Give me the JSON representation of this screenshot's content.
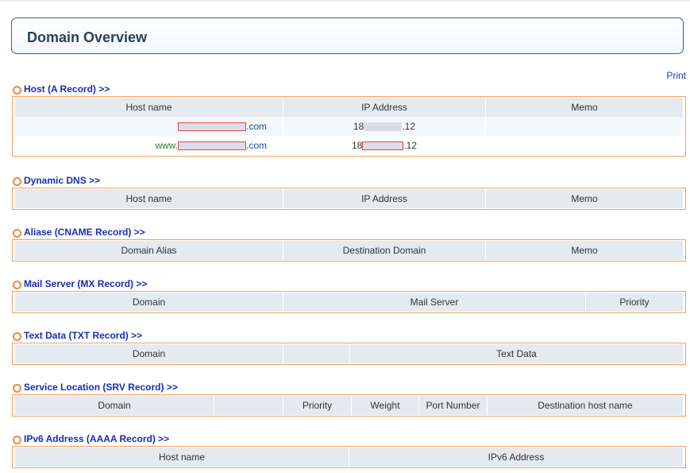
{
  "title": "Domain Overview",
  "print_label": "Print",
  "sections": {
    "a_record": {
      "title": "Host (A Record) >>",
      "headers": [
        "Host name",
        "IP Address",
        "Memo"
      ],
      "rows": [
        {
          "host_prefix": "",
          "host_suffix": ".com",
          "ip_prefix": "18",
          "ip_suffix": ".12",
          "memo": ""
        },
        {
          "host_prefix": "www.",
          "host_suffix": ".com",
          "ip_prefix": "18",
          "ip_suffix": ".12",
          "memo": ""
        }
      ]
    },
    "dyn_dns": {
      "title": "Dynamic DNS >>",
      "headers": [
        "Host name",
        "IP Address",
        "Memo"
      ]
    },
    "cname": {
      "title": "Aliase (CNAME Record) >>",
      "headers": [
        "Domain Alias",
        "Destination Domain",
        "Memo"
      ]
    },
    "mx": {
      "title": "Mail Server (MX Record) >>",
      "headers": [
        "Domain",
        "Mail Server",
        "Priority"
      ]
    },
    "txt": {
      "title": "Text Data (TXT Record) >>",
      "headers": [
        "Domain",
        "",
        "Text Data"
      ]
    },
    "srv": {
      "title": "Service Location (SRV Record) >>",
      "headers": [
        "Domain",
        "",
        "Priority",
        "Weight",
        "Port Number",
        "Destination host name"
      ]
    },
    "aaaa": {
      "title": "IPv6 Address (AAAA Record) >>",
      "headers": [
        "Host name",
        "IPv6 Address"
      ]
    }
  }
}
